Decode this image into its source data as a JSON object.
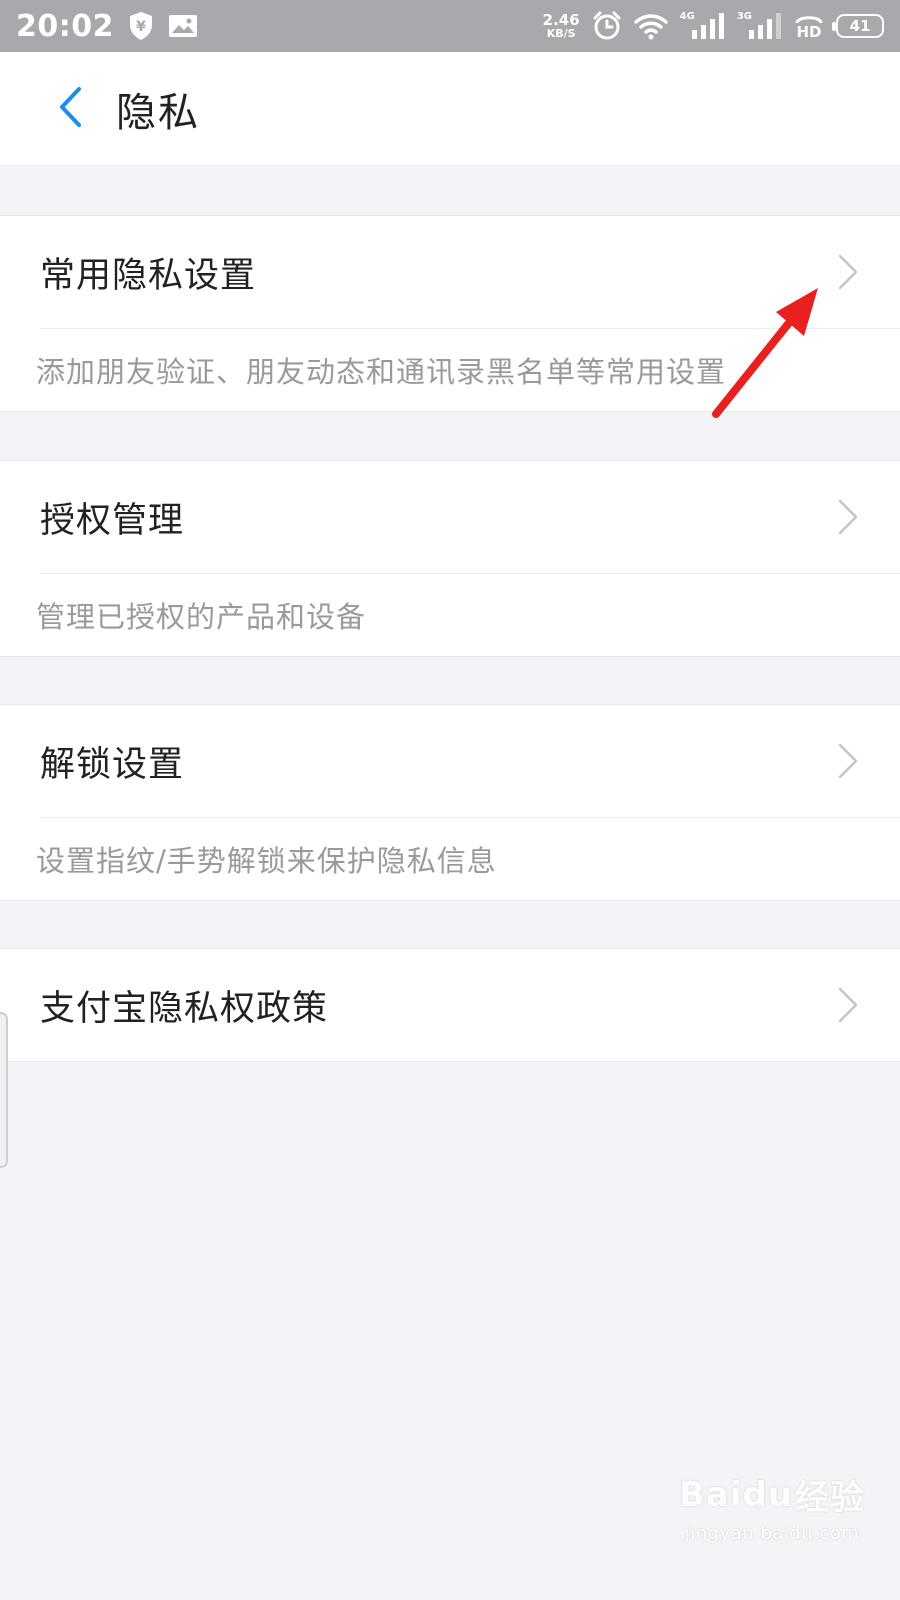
{
  "status_bar": {
    "time": "20:02",
    "net_speed_value": "2.46",
    "net_speed_unit": "KB/S",
    "sim1_type": "4G",
    "sim2_type": "3G",
    "hd_label": "HD",
    "battery_level": "41",
    "icons": [
      "shield-yen-icon",
      "image-notification-icon",
      "alarm-icon",
      "wifi-icon",
      "signal-4g-icon",
      "signal-3g-icon",
      "hd-voice-icon",
      "battery-icon"
    ]
  },
  "header": {
    "back_icon": "chevron-left-icon",
    "title": "隐私",
    "accent_color": "#1a8ee8"
  },
  "sections": [
    {
      "label": "常用隐私设置",
      "description": "添加朋友验证、朋友动态和通讯录黑名单等常用设置"
    },
    {
      "label": "授权管理",
      "description": "管理已授权的产品和设备"
    },
    {
      "label": "解锁设置",
      "description": "设置指纹/手势解锁来保护隐私信息"
    },
    {
      "label": "支付宝隐私权政策"
    }
  ],
  "annotation": {
    "type": "red-arrow",
    "color": "#e8201f"
  },
  "watermark": {
    "brand": "Baidu",
    "brand_cn": "经验",
    "url": "jingyan.baidu.com"
  }
}
